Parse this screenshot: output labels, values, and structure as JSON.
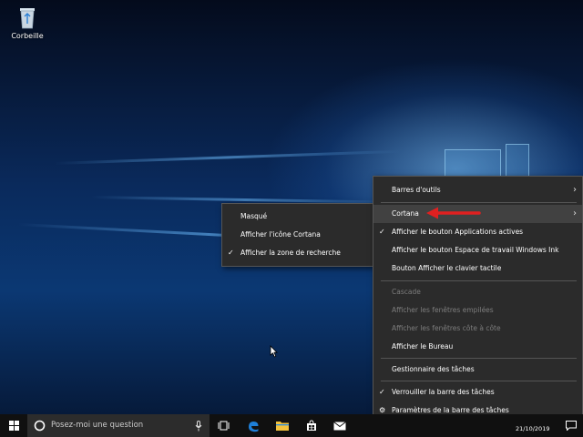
{
  "desktop": {
    "icons": [
      {
        "label": "Corbeille",
        "icon": "recycle-bin-icon"
      }
    ]
  },
  "taskbar_menu": {
    "items": [
      {
        "label": "Barres d'outils",
        "submenu": true
      },
      {
        "label": "Cortana",
        "submenu": true,
        "highlighted": true
      },
      {
        "label": "Afficher le bouton Applications actives",
        "checked": true
      },
      {
        "label": "Afficher le bouton Espace de travail Windows Ink"
      },
      {
        "label": "Bouton Afficher le clavier tactile"
      },
      {
        "label": "Cascade",
        "disabled": true
      },
      {
        "label": "Afficher les fenêtres empilées",
        "disabled": true
      },
      {
        "label": "Afficher les fenêtres côte à côte",
        "disabled": true
      },
      {
        "label": "Afficher le Bureau"
      },
      {
        "label": "Gestionnaire des tâches"
      },
      {
        "label": "Verrouiller la barre des tâches",
        "checked": true
      },
      {
        "label": "Paramètres de la barre des tâches",
        "icon": "gear-icon"
      }
    ]
  },
  "cortana_submenu": {
    "items": [
      {
        "label": "Masqué"
      },
      {
        "label": "Afficher l'icône Cortana"
      },
      {
        "label": "Afficher la zone de recherche",
        "checked": true
      }
    ]
  },
  "taskbar": {
    "search_placeholder": "Posez-moi une question",
    "pinned": [
      "task-view-icon",
      "edge-icon",
      "file-explorer-icon",
      "store-icon",
      "mail-icon"
    ],
    "date": "21/10/2019"
  },
  "colors": {
    "menu_bg": "#2b2b2b",
    "menu_highlight": "#414141",
    "annotation_arrow": "#e02020",
    "edge_blue": "#1e7fd8"
  }
}
